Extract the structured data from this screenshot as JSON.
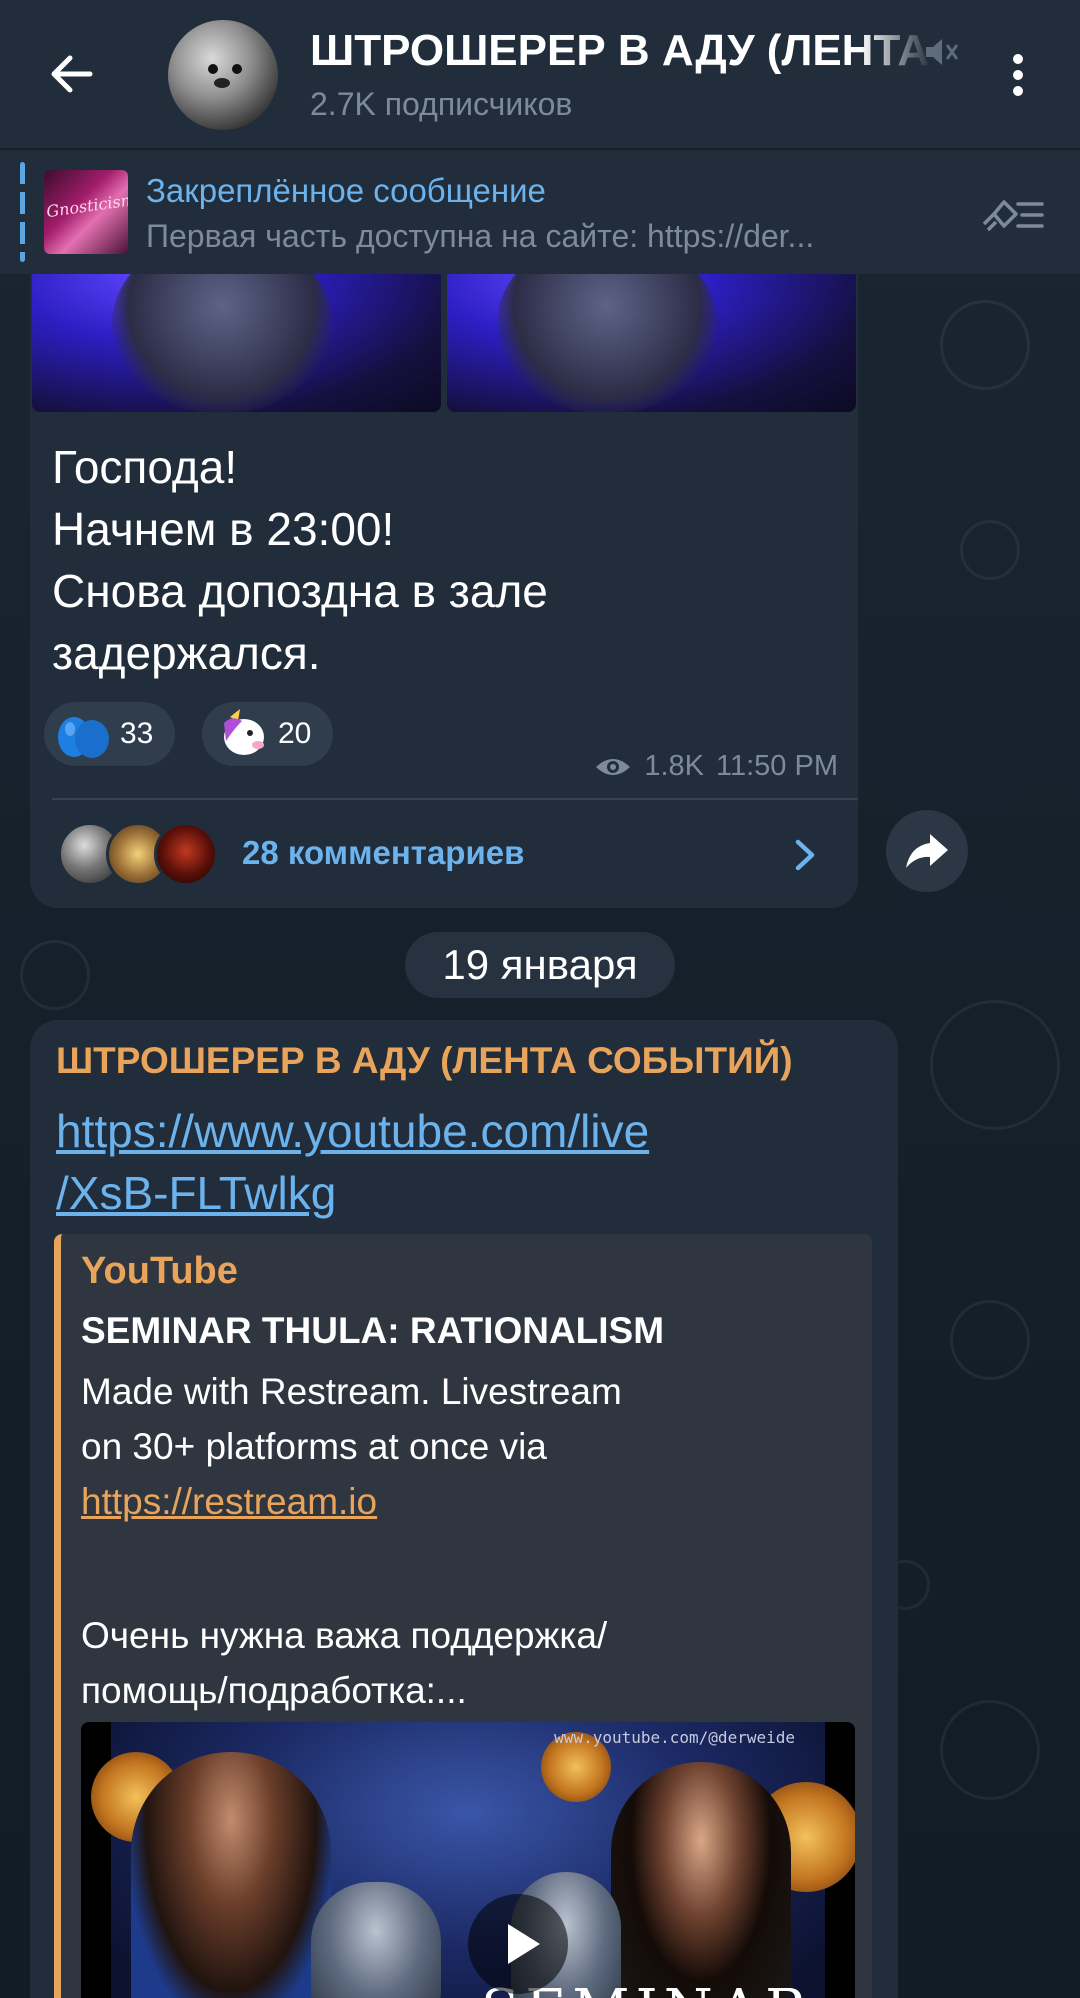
{
  "header": {
    "back_icon": "arrow-left-icon",
    "title": "ШТРОШЕРЕР В АДУ (ЛЕНТА СОБЫТИЙ)",
    "subtitle": "2.7K подписчиков",
    "mute_icon": "muted-speaker-icon",
    "more_icon": "vertical-dots-icon"
  },
  "pinned": {
    "title": "Закреплённое сообщение",
    "text": "Первая часть доступна на сайте:  https://der...",
    "thumb_text": "Gnosticism",
    "list_icon": "pinned-list-icon"
  },
  "message1": {
    "lines": [
      "Господа!",
      "Начнем в 23:00!",
      "Снова допоздна в зале",
      "задержался."
    ],
    "reactions": [
      {
        "emoji": "blue-balloons-emoji",
        "count": "33"
      },
      {
        "emoji": "unicorn-emoji",
        "count": "20"
      }
    ],
    "views": "1.8K",
    "time": "11:50 PM",
    "comments_label": "28 комментариев"
  },
  "date_chip": "19 января",
  "message2": {
    "author": "ШТРОШЕРЕР В АДУ (ЛЕНТА СОБЫТИЙ)",
    "link_line1": "https://www.youtube.com/live",
    "link_line2": "/XsB-FLTwlkg",
    "preview": {
      "site": "YouTube",
      "title": "SEMINAR THULA: RATIONALISM",
      "desc_line1": "Made with Restream. Livestream",
      "desc_line2": "on 30+ platforms at once via",
      "desc_url": "https://restream.io",
      "desc2_line1": "Очень нужна важа поддержка/",
      "desc2_line2": "помощь/подработка:...",
      "watermark": "www.youtube.com/@derweide",
      "image_text": "SEMINAR"
    }
  },
  "colors": {
    "header_bg": "#212d3b",
    "chat_bg": "#16212c",
    "bubble_bg": "#212d3b",
    "link": "#6cb3ee",
    "author": "#e9a45c",
    "muted_text": "#7d8b99"
  }
}
